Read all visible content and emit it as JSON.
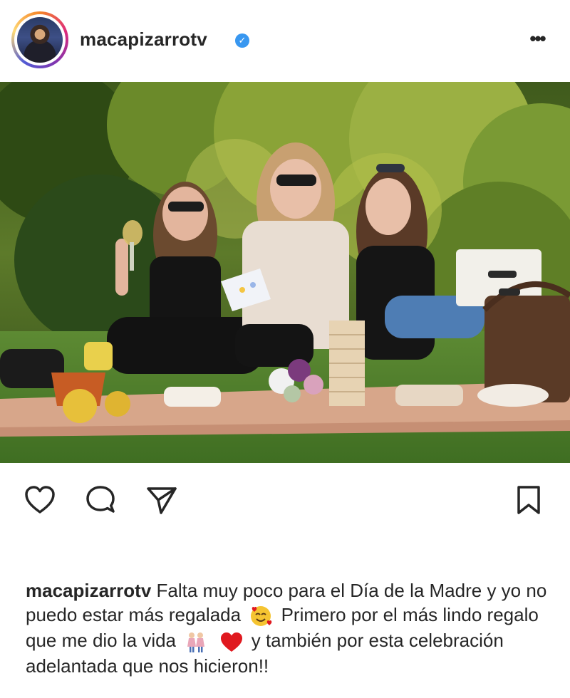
{
  "post": {
    "username": "macapizarrotv",
    "verified": true,
    "more_icon": "more-horizontal-icon"
  },
  "actions": {
    "like_icon": "heart-icon",
    "comment_icon": "comment-icon",
    "share_icon": "send-icon",
    "save_icon": "bookmark-icon"
  },
  "caption": {
    "username": "macapizarrotv",
    "text_1": "Falta muy poco para el Día de la Madre y yo no puedo estar más regalada",
    "text_2": "Primero por el más lindo regalo que me dio la vida",
    "text_3": "y también por esta celebración adelantada que nos hicieron!!",
    "emoji_1": "smiling-face-with-hearts-emoji",
    "emoji_2": "two-women-holding-hands-emoji",
    "emoji_3": "red-heart-emoji"
  },
  "colors": {
    "text": "#262626",
    "verified_badge": "#3897f0",
    "heart_emoji": "#e0191f"
  }
}
